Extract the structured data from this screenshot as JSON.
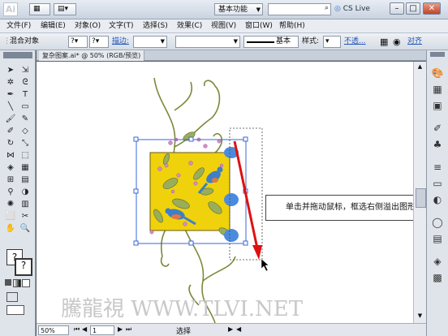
{
  "titlebar": {
    "logo": "Ai",
    "workspace": "基本功能",
    "cs_live": "CS Live",
    "window_controls": [
      "minimize-icon",
      "maximize-icon",
      "close-icon"
    ]
  },
  "menubar": [
    "文件(F)",
    "编辑(E)",
    "对象(O)",
    "文字(T)",
    "选择(S)",
    "效果(C)",
    "视图(V)",
    "窗口(W)",
    "帮助(H)"
  ],
  "controlbar": {
    "selection_label": "混合对象",
    "stroke_label": "描边:",
    "stroke_profile": "基本",
    "style_label": "样式:",
    "opacity_label": "不透...",
    "align_label": "对齐"
  },
  "document": {
    "tab": "复杂图案.ai* @ 50% (RGB/预览)",
    "zoom": "50%",
    "page": "1",
    "status": "选择"
  },
  "callout": "单击并拖动鼠标，框选右侧溢出图形",
  "watermark": "騰龍視 WWW.TLVI.NET",
  "colors": {
    "yellow": "#f0d20c",
    "selection": "#3a64d8",
    "arrow": "#e01010",
    "bird_blue": "#4a8be0"
  }
}
